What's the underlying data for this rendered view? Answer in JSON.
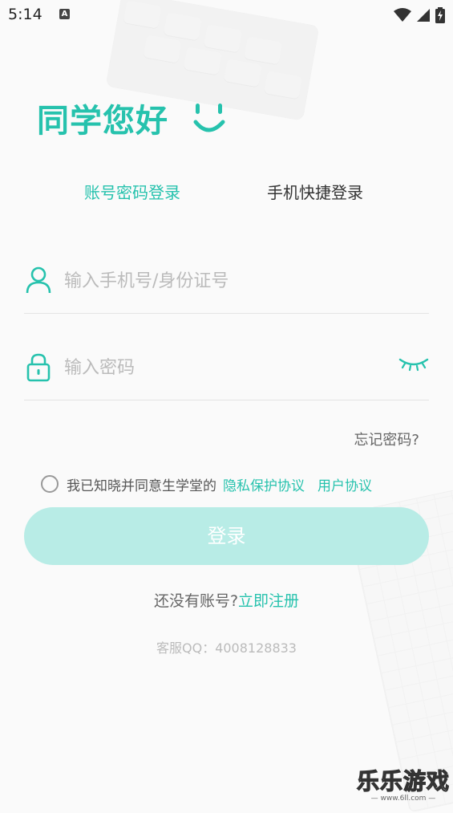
{
  "status_bar": {
    "time": "5:14",
    "a_icon": "A"
  },
  "greeting": "同学您好",
  "tabs": {
    "password_login": "账号密码登录",
    "phone_login": "手机快捷登录"
  },
  "account_field": {
    "placeholder": "输入手机号/身份证号",
    "value": "",
    "icon": "user-icon"
  },
  "password_field": {
    "placeholder": "输入密码",
    "value": "",
    "icon": "lock-icon",
    "toggle_icon": "eye-closed-icon"
  },
  "forgot_password": "忘记密码?",
  "agreement": {
    "text": "我已知晓并同意生学堂的",
    "privacy": "隐私保护协议",
    "user": "用户协议",
    "checked": false
  },
  "login_button": "登录",
  "register": {
    "question": "还没有账号?",
    "link": "立即注册"
  },
  "service": "客服QQ：4008128833",
  "watermark": {
    "title": "乐乐游戏",
    "url": "— www.6ll.com —"
  },
  "colors": {
    "accent": "#26c2ad",
    "button_disabled": "#b8ece6"
  }
}
